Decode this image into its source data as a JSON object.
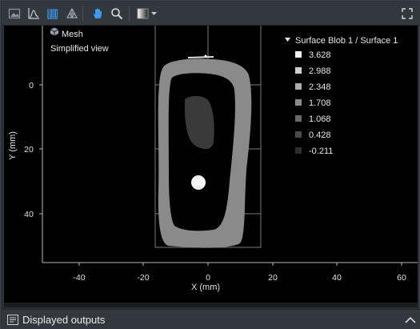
{
  "toolbar": {
    "buttons": [
      {
        "name": "image-view-icon",
        "active": false
      },
      {
        "name": "profile-view-icon",
        "active": false
      },
      {
        "name": "3d-view-icon",
        "active": true
      },
      {
        "name": "mesh-view-icon",
        "active": false
      },
      {
        "name": "pan-hand-icon",
        "active": true
      },
      {
        "name": "zoom-icon",
        "active": false
      },
      {
        "name": "gradient-palette-icon",
        "active": false
      }
    ],
    "accent": "#3b9bf0"
  },
  "overlay": {
    "mesh_label": "Mesh",
    "mode_label": "Simplified view"
  },
  "legend": {
    "title": "Surface Blob 1 / Surface 1",
    "entries": [
      {
        "label": "3.628",
        "color": "#f2f2f2"
      },
      {
        "label": "2.988",
        "color": "#cfcfcf"
      },
      {
        "label": "2.348",
        "color": "#ababab"
      },
      {
        "label": "1.708",
        "color": "#8a8a8a"
      },
      {
        "label": "1.068",
        "color": "#696969"
      },
      {
        "label": "0.428",
        "color": "#4a4a4a"
      },
      {
        "label": "-0.211",
        "color": "#2e2e2e"
      }
    ]
  },
  "axes": {
    "xlabel": "X (mm)",
    "ylabel": "Y (mm)",
    "x_ticks": [
      "-40",
      "-20",
      "0",
      "20",
      "40",
      "60"
    ],
    "y_ticks": [
      "0",
      "20",
      "40"
    ]
  },
  "status": {
    "label": "Displayed outputs"
  }
}
